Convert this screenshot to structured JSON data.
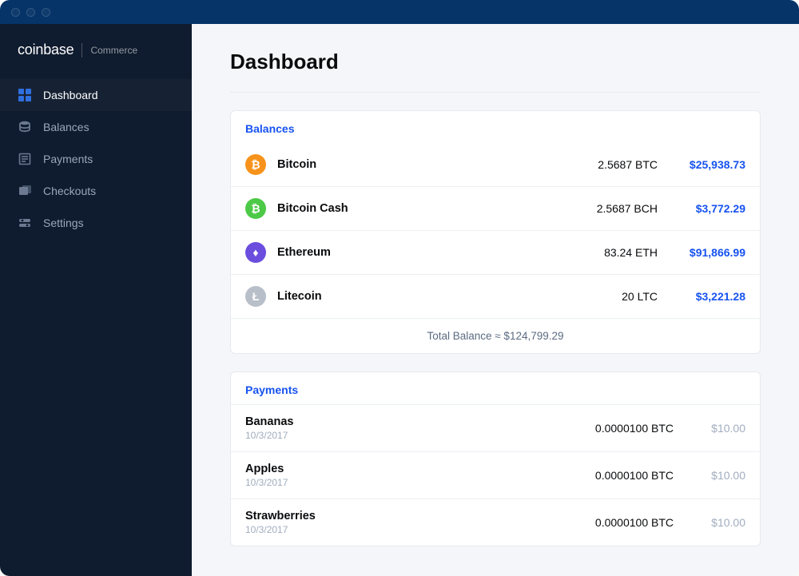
{
  "brand": {
    "main": "coinbase",
    "sub": "Commerce"
  },
  "nav": {
    "items": [
      {
        "label": "Dashboard"
      },
      {
        "label": "Balances"
      },
      {
        "label": "Payments"
      },
      {
        "label": "Checkouts"
      },
      {
        "label": "Settings"
      }
    ]
  },
  "page": {
    "title": "Dashboard"
  },
  "balances": {
    "heading": "Balances",
    "total_label": "Total Balance ≈ $124,799.29",
    "coins": [
      {
        "name": "Bitcoin",
        "qty": "2.5687 BTC",
        "usd": "$25,938.73",
        "color": "#f7931a",
        "glyph": "₿"
      },
      {
        "name": "Bitcoin Cash",
        "qty": "2.5687 BCH",
        "usd": "$3,772.29",
        "color": "#4cc947",
        "glyph": "₿"
      },
      {
        "name": "Ethereum",
        "qty": "83.24 ETH",
        "usd": "$91,866.99",
        "color": "#6b4ede",
        "glyph": "♦"
      },
      {
        "name": "Litecoin",
        "qty": "20 LTC",
        "usd": "$3,221.28",
        "color": "#b9bfc9",
        "glyph": "Ł"
      }
    ]
  },
  "payments": {
    "heading": "Payments",
    "rows": [
      {
        "name": "Bananas",
        "date": "10/3/2017",
        "qty": "0.0000100 BTC",
        "usd": "$10.00"
      },
      {
        "name": "Apples",
        "date": "10/3/2017",
        "qty": "0.0000100 BTC",
        "usd": "$10.00"
      },
      {
        "name": "Strawberries",
        "date": "10/3/2017",
        "qty": "0.0000100 BTC",
        "usd": "$10.00"
      }
    ]
  }
}
